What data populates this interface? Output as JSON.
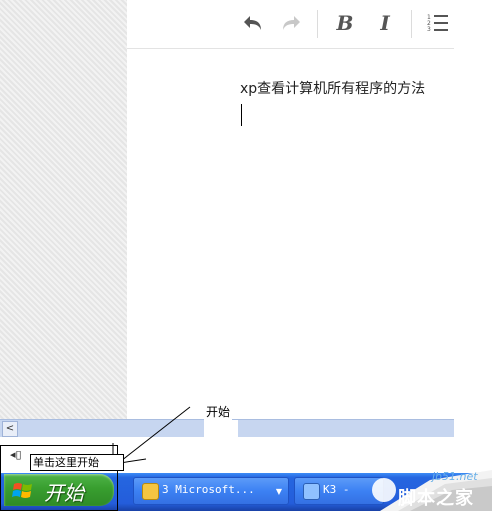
{
  "toolbar": {
    "undo": "undo-icon",
    "redo": "redo-icon",
    "bold_label": "B",
    "italic_label": "I",
    "list": "ordered-list-icon"
  },
  "document": {
    "text": "xp查看计算机所有程序的方法"
  },
  "annotation": {
    "label": "开始",
    "callout": "单击这里开始"
  },
  "taskbar": {
    "start_label": "开始",
    "tray_symbol": "◂▯",
    "tasks": [
      {
        "label": "3 Microsoft...",
        "icon": "outlook-icon"
      },
      {
        "label": "K3 -",
        "icon": "k3-app-icon"
      }
    ]
  },
  "watermark": {
    "url": "jb51.net",
    "name": "脚本之家"
  },
  "colors": {
    "taskbar_blue": "#245ddb",
    "start_green": "#389e2f",
    "scroll_blue": "#c7d6f0"
  }
}
